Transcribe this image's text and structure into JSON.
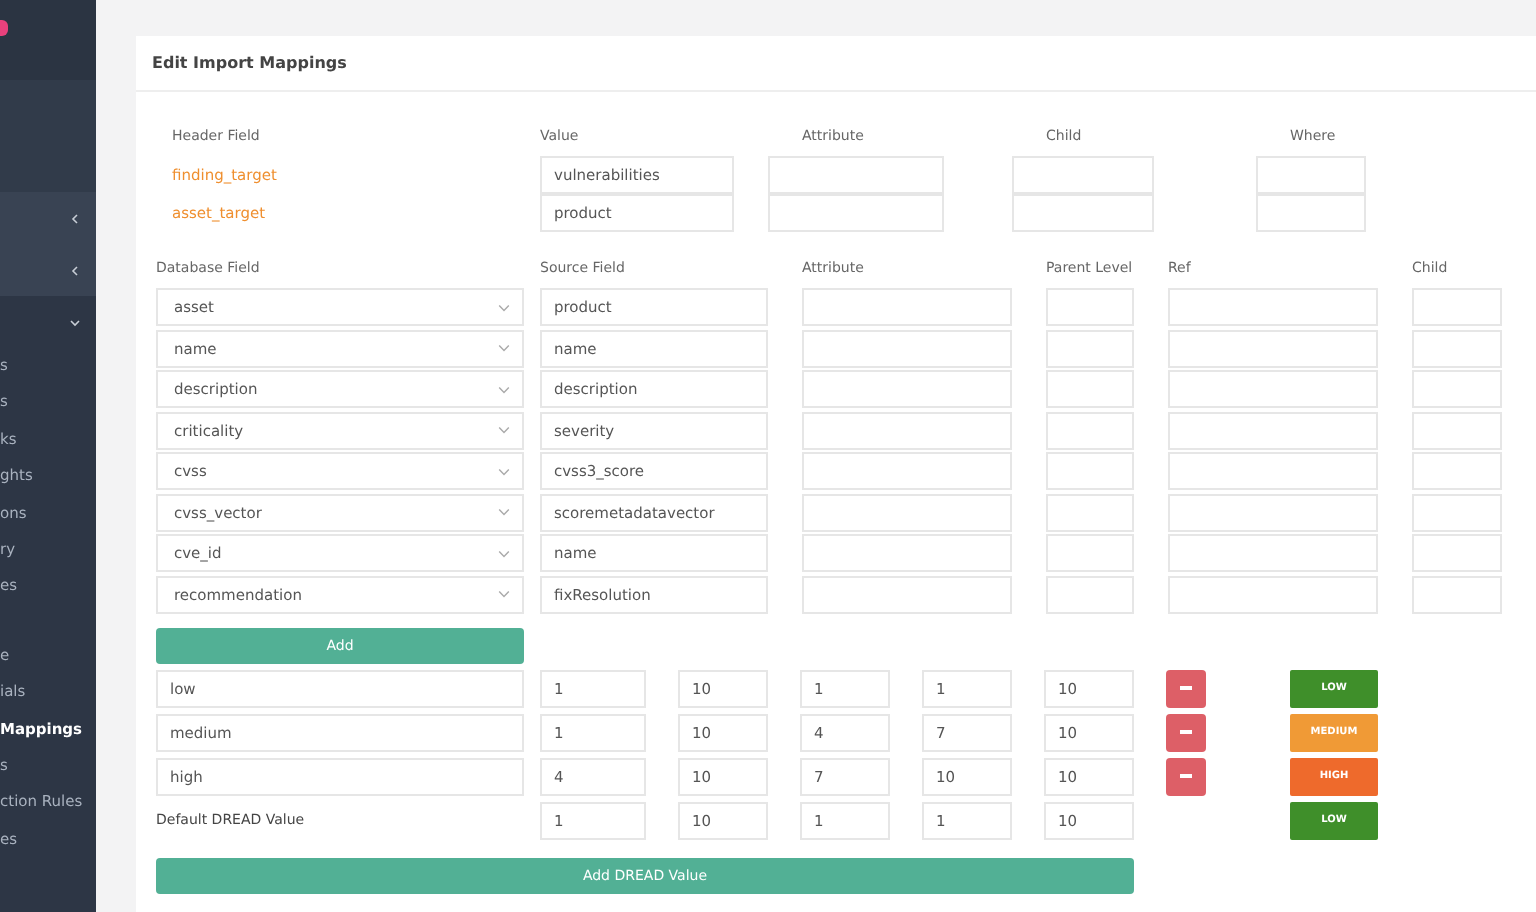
{
  "sidebar": {
    "items": [
      {
        "label": "s",
        "selected": false
      },
      {
        "label": "s",
        "selected": false
      },
      {
        "label": "ks",
        "selected": false
      },
      {
        "label": "ghts",
        "selected": false
      },
      {
        "label": "ons",
        "selected": false
      },
      {
        "label": "ry",
        "selected": false
      },
      {
        "label": "es",
        "selected": false
      },
      {
        "label": "e",
        "selected": false
      },
      {
        "label": "ials",
        "selected": false
      },
      {
        "label": "Mappings",
        "selected": true
      },
      {
        "label": "s",
        "selected": false
      },
      {
        "label": "ction Rules",
        "selected": false
      },
      {
        "label": "es",
        "selected": false
      }
    ]
  },
  "card": {
    "title": "Edit Import Mappings",
    "header_columns": [
      "Header Field",
      "Value",
      "Attribute",
      "Child",
      "Where"
    ],
    "header_rows": [
      {
        "field": "finding_target",
        "value": "vulnerabilities"
      },
      {
        "field": "asset_target",
        "value": "product"
      }
    ],
    "mapping_columns": [
      "Database Field",
      "Source Field",
      "Attribute",
      "Parent Level",
      "Ref",
      "Child"
    ],
    "mapping_rows": [
      {
        "database_field": "asset",
        "source_field": "product"
      },
      {
        "database_field": "name",
        "source_field": "name"
      },
      {
        "database_field": "description",
        "source_field": "description"
      },
      {
        "database_field": "criticality",
        "source_field": "severity"
      },
      {
        "database_field": "cvss",
        "source_field": "cvss3_score"
      },
      {
        "database_field": "cvss_vector",
        "source_field": "scoremetadatavector"
      },
      {
        "database_field": "cve_id",
        "source_field": "name"
      },
      {
        "database_field": "recommendation",
        "source_field": "fixResolution"
      }
    ],
    "add_button": "Add",
    "dread_rows": [
      {
        "kind": "editable",
        "name": "low",
        "values": [
          "1",
          "10",
          "1",
          "1",
          "10"
        ],
        "badge": "LOW",
        "color": "#3f8f2a"
      },
      {
        "kind": "editable",
        "name": "medium",
        "values": [
          "1",
          "10",
          "4",
          "7",
          "10"
        ],
        "badge": "MEDIUM",
        "color": "#f09a36"
      },
      {
        "kind": "editable",
        "name": "high",
        "values": [
          "4",
          "10",
          "7",
          "10",
          "10"
        ],
        "badge": "HIGH",
        "color": "#ee6a2c"
      },
      {
        "kind": "default",
        "name": "Default DREAD Value",
        "values": [
          "1",
          "10",
          "1",
          "1",
          "10"
        ],
        "badge": "LOW",
        "color": "#3f8f2a"
      }
    ],
    "add_dread_button": "Add DREAD Value"
  }
}
